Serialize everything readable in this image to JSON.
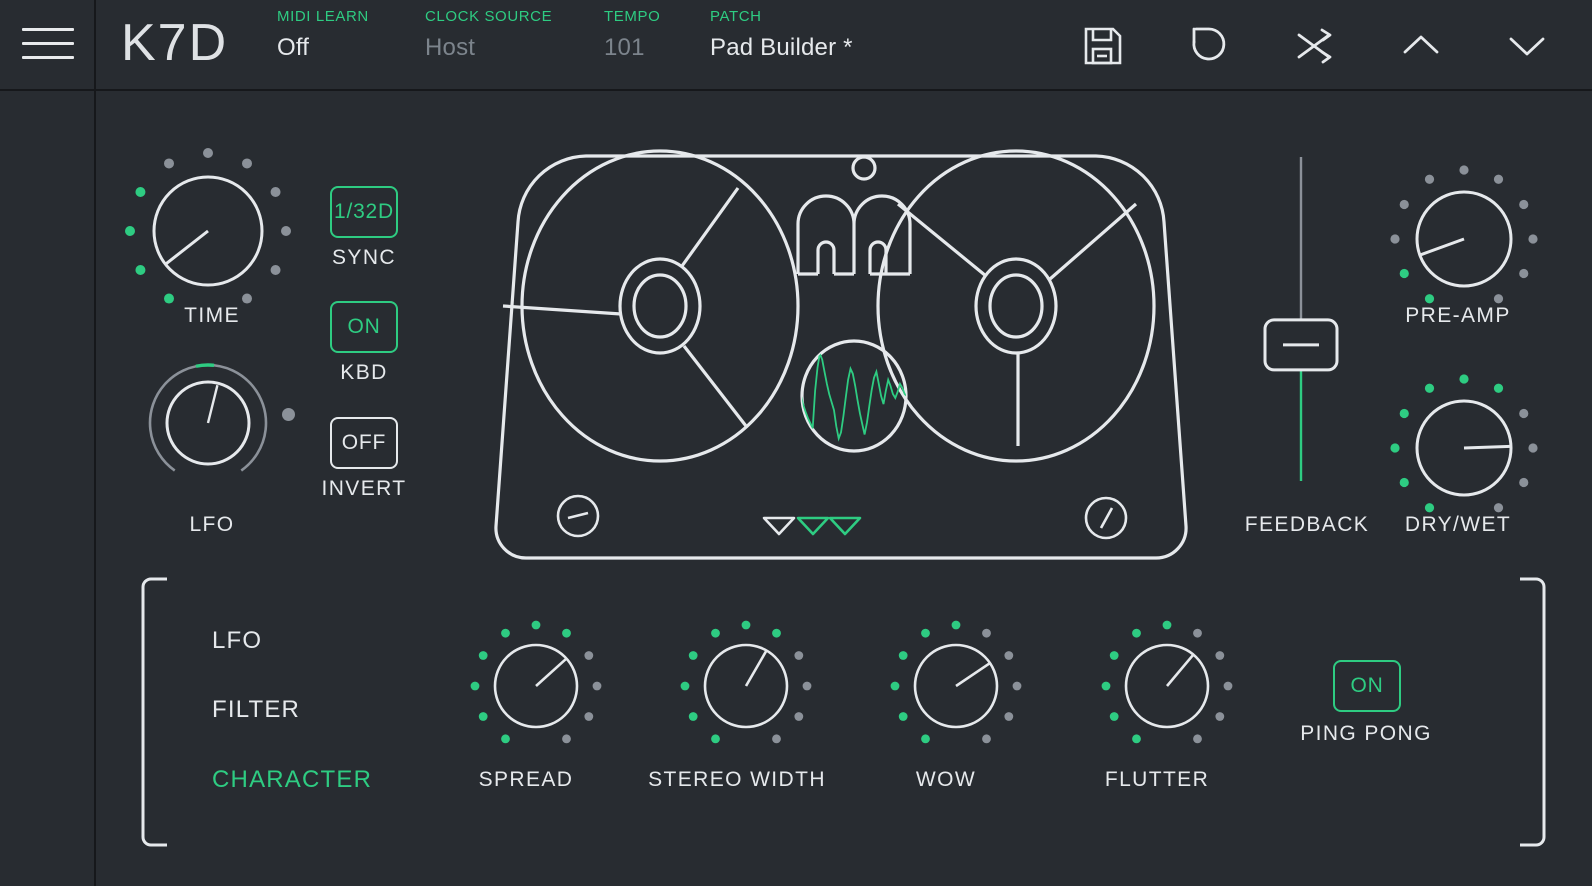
{
  "app": {
    "title": "K7D",
    "bg": "#282c31",
    "accent": "#2ecc82",
    "foreground": "#e6e9ec",
    "dim": "#7c848c"
  },
  "header": {
    "menu_icon": "hamburger-icon",
    "brand": "K7D",
    "fields": [
      {
        "label": "MIDI LEARN",
        "value": "Off",
        "dim": false
      },
      {
        "label": "CLOCK SOURCE",
        "value": "Host",
        "dim": true
      },
      {
        "label": "TEMPO",
        "value": "101",
        "dim": true
      },
      {
        "label": "PATCH",
        "value": "Pad Builder *",
        "dim": false
      }
    ],
    "icons": [
      {
        "name": "save-icon",
        "glyph": "floppy-disk"
      },
      {
        "name": "undo-icon",
        "glyph": "undo-arrow"
      },
      {
        "name": "randomize-icon",
        "glyph": "shuffle"
      },
      {
        "name": "preset-prev-icon",
        "glyph": "chevron-up"
      },
      {
        "name": "preset-next-icon",
        "glyph": "chevron-down"
      }
    ]
  },
  "delay_section": {
    "time_knob": {
      "label": "TIME",
      "angle_deg": -128,
      "lit_dots": 4,
      "total_dots": 11
    },
    "lfo_knob": {
      "label": "LFO",
      "angle_deg": 14,
      "ring": true
    },
    "toggles": [
      {
        "label": "SYNC",
        "value": "1/32D",
        "state": "on"
      },
      {
        "label": "KBD",
        "value": "ON",
        "state": "on"
      },
      {
        "label": "INVERT",
        "value": "OFF",
        "state": "off"
      }
    ]
  },
  "tape_deck": {
    "logo": "m-logo",
    "left_reel": "reel-left",
    "right_reel": "reel-right",
    "scope": "waveform-scope",
    "left_badge": "minus-badge",
    "right_badge": "slash-badge",
    "indicators": [
      {
        "name": "tape-indicator-1",
        "lit": false
      },
      {
        "name": "tape-indicator-2",
        "lit": true
      },
      {
        "name": "tape-indicator-3",
        "lit": true
      }
    ],
    "waveform": [
      0.5,
      0.41,
      0.34,
      0.28,
      0.23,
      0.18,
      0.55,
      0.78,
      0.92,
      0.86,
      0.74,
      0.62,
      0.52,
      0.44,
      0.36,
      0.2,
      0.08,
      0.14,
      0.3,
      0.48,
      0.66,
      0.77,
      0.72,
      0.6,
      0.46,
      0.33,
      0.22,
      0.12,
      0.24,
      0.4,
      0.56,
      0.68,
      0.74,
      0.62,
      0.5,
      0.42,
      0.55,
      0.66,
      0.6,
      0.52,
      0.48,
      0.54,
      0.62,
      0.58,
      0.52,
      0.5
    ]
  },
  "output_section": {
    "feedback": {
      "label": "FEEDBACK",
      "value_pct": 42
    },
    "preamp": {
      "label": "PRE-AMP",
      "angle_deg": -110,
      "lit_dots": 2,
      "total_dots": 11
    },
    "drywet": {
      "label": "DRY/WET",
      "angle_deg": 88,
      "lit_dots": 7,
      "total_dots": 11
    }
  },
  "bottom_section": {
    "modes": [
      {
        "label": "LFO",
        "active": false
      },
      {
        "label": "FILTER",
        "active": false
      },
      {
        "label": "CHARACTER",
        "active": true
      }
    ],
    "knobs": [
      {
        "label": "SPREAD",
        "angle_deg": 48,
        "lit_dots": 7,
        "total_dots": 11
      },
      {
        "label": "STEREO WIDTH",
        "angle_deg": 30,
        "lit_dots": 7,
        "total_dots": 11
      },
      {
        "label": "WOW",
        "angle_deg": 56,
        "lit_dots": 6,
        "total_dots": 11
      },
      {
        "label": "FLUTTER",
        "angle_deg": 40,
        "lit_dots": 6,
        "total_dots": 11
      }
    ],
    "ping_pong": {
      "label": "PING PONG",
      "value": "ON",
      "state": "on"
    }
  }
}
